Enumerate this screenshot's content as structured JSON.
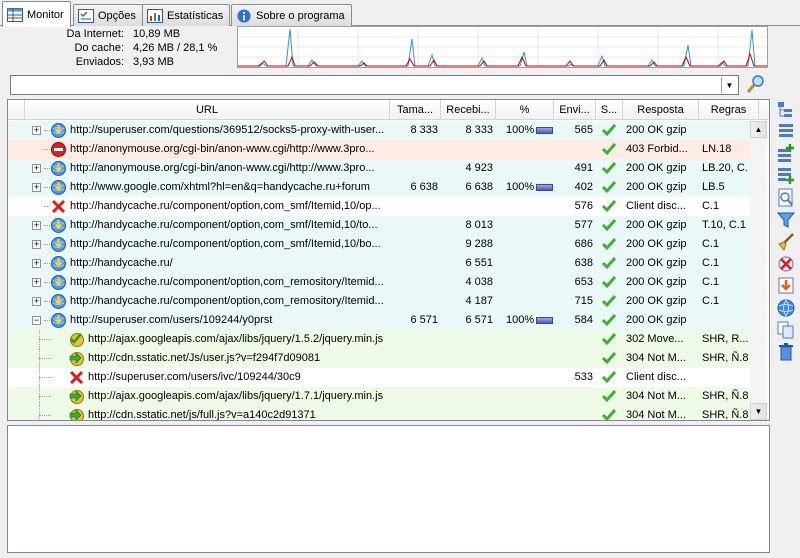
{
  "tabs": [
    {
      "label": "Monitor",
      "icon": "monitor-table-icon",
      "active": true
    },
    {
      "label": "Opções",
      "icon": "options-icon",
      "active": false
    },
    {
      "label": "Estatísticas",
      "icon": "statistics-icon",
      "active": false
    },
    {
      "label": "Sobre o programa",
      "icon": "info-icon",
      "active": false
    }
  ],
  "stats": [
    {
      "label": "Da Internet:",
      "value": "10,89 MB"
    },
    {
      "label": "Do cache:",
      "value": "4,26 MB / 28,1 %"
    },
    {
      "label": "Enviados:",
      "value": "3,93 MB"
    }
  ],
  "filter": {
    "value": ""
  },
  "columns": [
    "URL",
    "Tama...",
    "Recebi...",
    "%",
    "Envi...",
    "S...",
    "Resposta",
    "Regras"
  ],
  "rows": [
    {
      "url": "http://superuser.com/questions/369512/socks5-proxy-with-user...",
      "size": "8 333",
      "received": "8 333",
      "percent": "100%",
      "sent": "565",
      "resp": "200 OK gzip",
      "rules": "",
      "bg": "#eaf8f8",
      "icon": "globe-download-icon",
      "status": "ok",
      "expand": "+",
      "indent": 0,
      "bar": true
    },
    {
      "url": "http://anonymouse.org/cgi-bin/anon-www.cgi/http://www.3pro...",
      "size": "",
      "received": "",
      "percent": "",
      "sent": "",
      "resp": "403 Forbid...",
      "rules": "LN.18",
      "bg": "#fdece4",
      "icon": "blocked-icon",
      "status": "ok",
      "expand": "",
      "indent": 0,
      "bar": false
    },
    {
      "url": "http://anonymouse.org/cgi-bin/anon-www.cgi/http://www.3pro...",
      "size": "",
      "received": "4 923",
      "percent": "",
      "sent": "491",
      "resp": "200 OK gzip",
      "rules": "LB.20, C.",
      "bg": "#eaf8f8",
      "icon": "globe-download-icon",
      "status": "ok",
      "expand": "+",
      "indent": 0,
      "bar": false
    },
    {
      "url": "http://www.google.com/xhtml?hl=en&q=handycache.ru+forum",
      "size": "6 638",
      "received": "6 638",
      "percent": "100%",
      "sent": "402",
      "resp": "200 OK gzip",
      "rules": "LB.5",
      "bg": "#eaf8f8",
      "icon": "globe-download-icon",
      "status": "ok",
      "expand": "+",
      "indent": 0,
      "bar": true
    },
    {
      "url": "http://handycache.ru/component/option,com_smf/Itemid,10/op...",
      "size": "",
      "received": "",
      "percent": "",
      "sent": "576",
      "resp": "Client disc...",
      "rules": "C.1",
      "bg": "#ffffff",
      "icon": "red-x-icon",
      "status": "ok",
      "expand": "",
      "indent": 0,
      "bar": false
    },
    {
      "url": "http://handycache.ru/component/option,com_smf/Itemid,10/to...",
      "size": "",
      "received": "8 013",
      "percent": "",
      "sent": "577",
      "resp": "200 OK gzip",
      "rules": "T.10, C.1",
      "bg": "#eaf8f8",
      "icon": "globe-download-icon",
      "status": "ok",
      "expand": "+",
      "indent": 0,
      "bar": false
    },
    {
      "url": "http://handycache.ru/component/option,com_smf/Itemid,10/bo...",
      "size": "",
      "received": "9 288",
      "percent": "",
      "sent": "686",
      "resp": "200 OK gzip",
      "rules": "C.1",
      "bg": "#eaf8f8",
      "icon": "globe-download-icon",
      "status": "ok",
      "expand": "+",
      "indent": 0,
      "bar": false
    },
    {
      "url": "http://handycache.ru/",
      "size": "",
      "received": "6 551",
      "percent": "",
      "sent": "638",
      "resp": "200 OK gzip",
      "rules": "C.1",
      "bg": "#eaf8f8",
      "icon": "globe-download-icon",
      "status": "ok",
      "expand": "+",
      "indent": 0,
      "bar": false
    },
    {
      "url": "http://handycache.ru/component/option,com_remository/Itemid...",
      "size": "",
      "received": "4 038",
      "percent": "",
      "sent": "653",
      "resp": "200 OK gzip",
      "rules": "C.1",
      "bg": "#eaf8f8",
      "icon": "globe-download-icon",
      "status": "ok",
      "expand": "+",
      "indent": 0,
      "bar": false
    },
    {
      "url": "http://handycache.ru/component/option,com_remository/Itemid...",
      "size": "",
      "received": "4 187",
      "percent": "",
      "sent": "715",
      "resp": "200 OK gzip",
      "rules": "C.1",
      "bg": "#eaf8f8",
      "icon": "globe-download-icon",
      "status": "ok",
      "expand": "+",
      "indent": 0,
      "bar": false
    },
    {
      "url": "http://superuser.com/users/109244/y0prst",
      "size": "6 571",
      "received": "6 571",
      "percent": "100%",
      "sent": "584",
      "resp": "200 OK gzip",
      "rules": "",
      "bg": "#eaf8f8",
      "icon": "globe-download-icon",
      "status": "ok",
      "expand": "-",
      "indent": 0,
      "bar": true
    },
    {
      "url": "http://ajax.googleapis.com/ajax/libs/jquery/1.5.2/jquery.min.js",
      "size": "",
      "received": "",
      "percent": "",
      "sent": "",
      "resp": "302 Move...",
      "rules": "SHR, R...",
      "bg": "#eefbe6",
      "icon": "cache-check-icon",
      "status": "ok",
      "expand": "",
      "indent": 1,
      "bar": false
    },
    {
      "url": "http://cdn.sstatic.net/Js/user.js?v=f294f7d09081",
      "size": "",
      "received": "",
      "percent": "",
      "sent": "",
      "resp": "304 Not M...",
      "rules": "SHR, Ñ.8",
      "bg": "#eefbe6",
      "icon": "cache-arrow-icon",
      "status": "ok",
      "expand": "",
      "indent": 1,
      "bar": false
    },
    {
      "url": "http://superuser.com/users/ivc/109244/30c9",
      "size": "",
      "received": "",
      "percent": "",
      "sent": "533",
      "resp": "Client disc...",
      "rules": "",
      "bg": "#ffffff",
      "icon": "red-x-icon",
      "status": "ok",
      "expand": "",
      "indent": 1,
      "bar": false
    },
    {
      "url": "http://ajax.googleapis.com/ajax/libs/jquery/1.7.1/jquery.min.js",
      "size": "",
      "received": "",
      "percent": "",
      "sent": "",
      "resp": "304 Not M...",
      "rules": "SHR, Ñ.8",
      "bg": "#eefbe6",
      "icon": "cache-arrow-icon",
      "status": "ok",
      "expand": "",
      "indent": 1,
      "bar": false
    },
    {
      "url": "http://cdn.sstatic.net/js/full.js?v=a140c2d91371",
      "size": "",
      "received": "",
      "percent": "",
      "sent": "",
      "resp": "304 Not M...",
      "rules": "SHR, Ñ.8",
      "bg": "#eefbe6",
      "icon": "cache-arrow-icon",
      "status": "ok",
      "expand": "",
      "indent": 1,
      "bar": false
    }
  ],
  "toolbar": [
    "collapse-tree-icon",
    "list-view-icon",
    "add-rule-icon",
    "add-rule-2-icon",
    "find-page-icon",
    "filter-icon",
    "clean-brush-icon",
    "delete-from-cache-icon",
    "download-icon",
    "browser-globe-icon",
    "copy-icon",
    "trash-icon"
  ],
  "colors": {
    "graph_red": "#c00000",
    "graph_blue": "#3a8fd8",
    "ok_green": "#3cb030"
  }
}
